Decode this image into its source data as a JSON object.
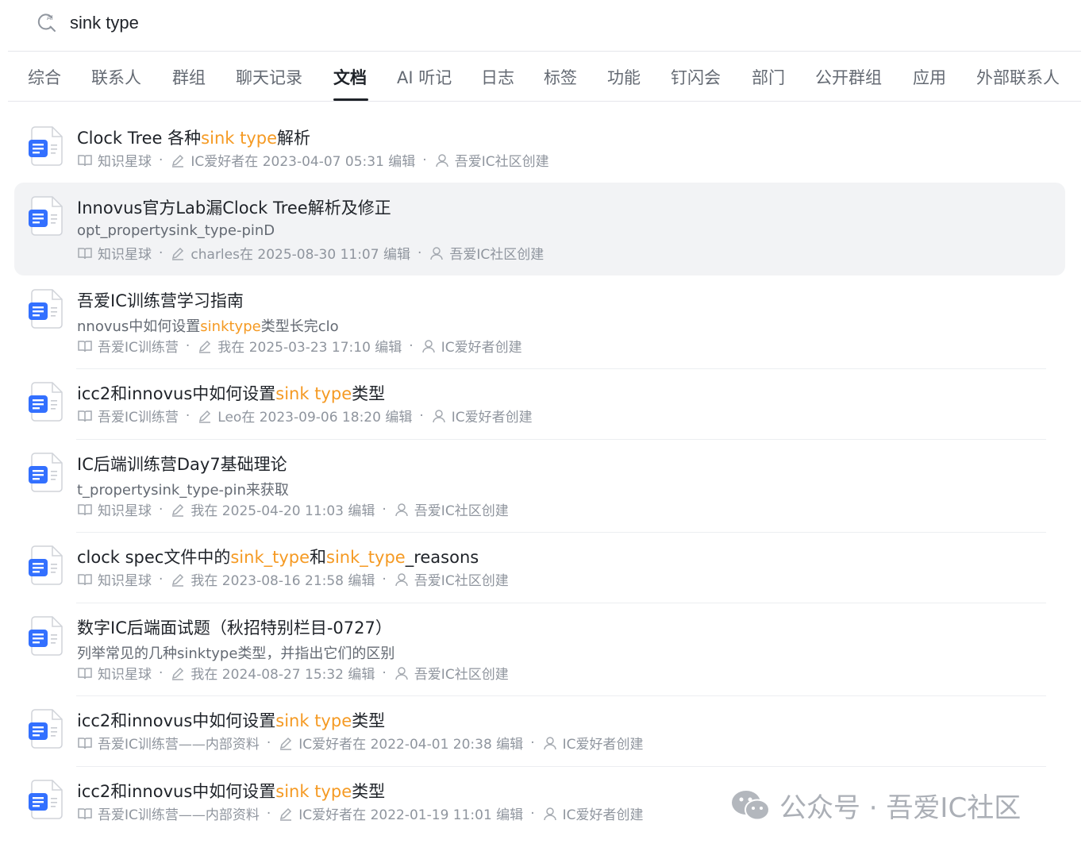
{
  "search": {
    "value": "sink type"
  },
  "tabs": [
    {
      "label": "综合"
    },
    {
      "label": "联系人"
    },
    {
      "label": "群组"
    },
    {
      "label": "聊天记录"
    },
    {
      "label": "文档",
      "active": true
    },
    {
      "label": "AI 听记"
    },
    {
      "label": "日志"
    },
    {
      "label": "标签"
    },
    {
      "label": "功能"
    },
    {
      "label": "钉闪会"
    },
    {
      "label": "部门"
    },
    {
      "label": "公开群组"
    },
    {
      "label": "应用"
    },
    {
      "label": "外部联系人"
    }
  ],
  "results": [
    {
      "title": [
        {
          "t": "Clock Tree 各种"
        },
        {
          "t": "sink type",
          "hl": true
        },
        {
          "t": "解析"
        }
      ],
      "snippet": null,
      "space": "知识星球",
      "edited": "IC爱好者在 2023-04-07 05:31 编辑",
      "creator": "吾爱IC社区创建"
    },
    {
      "title": [
        {
          "t": "Innovus官方Lab漏Clock Tree解析及修正"
        }
      ],
      "snippet": [
        {
          "t": "opt_propertysink_type-pinD"
        }
      ],
      "space": "知识星球",
      "edited": "charles在 2025-08-30 11:07 编辑",
      "creator": "吾爱IC社区创建",
      "highlight": true
    },
    {
      "title": [
        {
          "t": "吾爱IC训练营学习指南"
        }
      ],
      "snippet": [
        {
          "t": "nnovus中如何设置"
        },
        {
          "t": "sinktype",
          "hl": true
        },
        {
          "t": "类型长完clo"
        }
      ],
      "space": "吾爱IC训练营",
      "edited": "我在 2025-03-23 17:10 编辑",
      "creator": "IC爱好者创建"
    },
    {
      "title": [
        {
          "t": "icc2和innovus中如何设置"
        },
        {
          "t": "sink type",
          "hl": true
        },
        {
          "t": "类型"
        }
      ],
      "snippet": null,
      "space": "吾爱IC训练营",
      "edited": "Leo在 2023-09-06 18:20 编辑",
      "creator": "IC爱好者创建"
    },
    {
      "title": [
        {
          "t": "IC后端训练营Day7基础理论"
        }
      ],
      "snippet": [
        {
          "t": "t_propertysink_type-pin来获取"
        }
      ],
      "space": "知识星球",
      "edited": "我在 2025-04-20 11:03 编辑",
      "creator": "吾爱IC社区创建"
    },
    {
      "title": [
        {
          "t": "clock spec文件中的"
        },
        {
          "t": "sink_type",
          "hl": true
        },
        {
          "t": "和"
        },
        {
          "t": "sink_type",
          "hl": true
        },
        {
          "t": "_reasons"
        }
      ],
      "snippet": null,
      "space": "知识星球",
      "edited": "我在 2023-08-16 21:58 编辑",
      "creator": "吾爱IC社区创建"
    },
    {
      "title": [
        {
          "t": "数字IC后端面试题（秋招特别栏目-0727）"
        }
      ],
      "snippet": [
        {
          "t": "列举常见的几种sinktype类型，并指出它们的区别"
        }
      ],
      "space": "知识星球",
      "edited": "我在 2024-08-27 15:32 编辑",
      "creator": "吾爱IC社区创建"
    },
    {
      "title": [
        {
          "t": "icc2和innovus中如何设置"
        },
        {
          "t": "sink type",
          "hl": true
        },
        {
          "t": "类型"
        }
      ],
      "snippet": null,
      "space": "吾爱IC训练营——内部资料",
      "edited": "IC爱好者在 2022-04-01 20:38 编辑",
      "creator": "IC爱好者创建"
    },
    {
      "title": [
        {
          "t": "icc2和innovus中如何设置"
        },
        {
          "t": "sink type",
          "hl": true
        },
        {
          "t": "类型"
        }
      ],
      "snippet": null,
      "space": "吾爱IC训练营——内部资料",
      "edited": "IC爱好者在 2022-01-19 11:01 编辑",
      "creator": "IC爱好者创建"
    }
  ],
  "watermark": {
    "text": "公众号 · 吾爱IC社区"
  },
  "colors": {
    "accent": "#f59a23",
    "doc_icon": "#3370ff",
    "active_tab": "#1f2329"
  }
}
